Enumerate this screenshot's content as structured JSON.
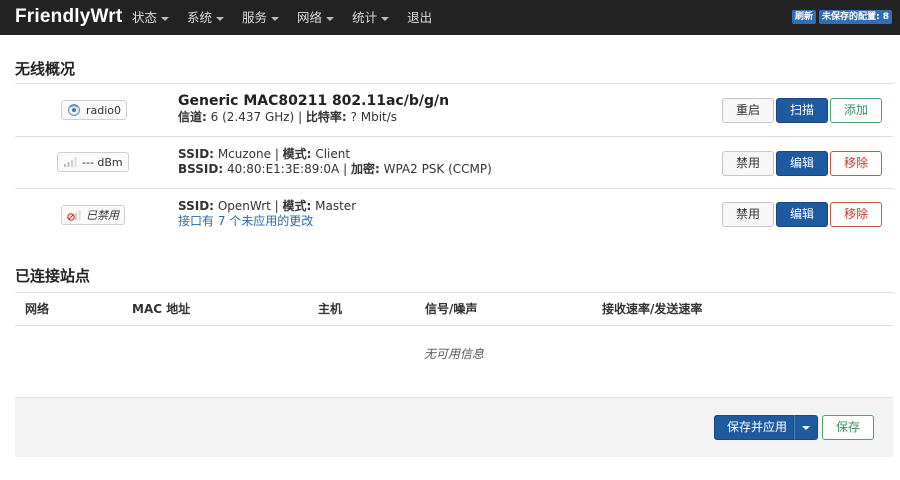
{
  "header": {
    "brand": "FriendlyWrt",
    "nav": [
      {
        "label": "状态",
        "has_caret": true
      },
      {
        "label": "系统",
        "has_caret": true
      },
      {
        "label": "服务",
        "has_caret": true
      },
      {
        "label": "网络",
        "has_caret": true
      },
      {
        "label": "统计",
        "has_caret": true
      },
      {
        "label": "退出",
        "has_caret": false
      }
    ],
    "badges": {
      "refresh": "刷新",
      "unsaved": "未保存的配置: 8"
    }
  },
  "wireless": {
    "title": "无线概况",
    "radio": {
      "device_label": "radio0",
      "device_icon": "wifi-radio-icon",
      "name": "Generic MAC80211 802.11ac/b/g/n",
      "channel_label": "信道:",
      "channel_value": "6 (2.437 GHz)",
      "bitrate_label": "比特率:",
      "bitrate_value": "? Mbit/s",
      "buttons": {
        "restart": "重启",
        "scan": "扫描",
        "add": "添加"
      }
    },
    "networks": [
      {
        "status_text": "--- dBm",
        "status_icon": "signal-icon",
        "ssid_label": "SSID:",
        "ssid_value": "Mcuzone",
        "mode_label": "模式:",
        "mode_value": "Client",
        "bssid_label": "BSSID:",
        "bssid_value": "40:80:E1:3E:89:0A",
        "enc_label": "加密:",
        "enc_value": "WPA2 PSK (CCMP)",
        "buttons": {
          "disable": "禁用",
          "edit": "编辑",
          "remove": "移除"
        }
      },
      {
        "status_text": "已禁用",
        "status_icon": "disabled-signal-icon",
        "ssid_label": "SSID:",
        "ssid_value": "OpenWrt",
        "mode_label": "模式:",
        "mode_value": "Master",
        "pending_text": "接口有 7 个未应用的更改",
        "buttons": {
          "disable": "禁用",
          "edit": "编辑",
          "remove": "移除"
        }
      }
    ]
  },
  "stations": {
    "title": "已连接站点",
    "columns": [
      "网络",
      "MAC 地址",
      "主机",
      "信号/噪声",
      "接收速率/发送速率"
    ],
    "empty_text": "无可用信息"
  },
  "footer": {
    "save_apply": "保存并应用",
    "save": "保存"
  },
  "colors": {
    "primary": "#1e5aa0",
    "success": "#3a9160",
    "danger": "#c0392b",
    "topbar": "#232323",
    "link": "#2a6aa8"
  }
}
